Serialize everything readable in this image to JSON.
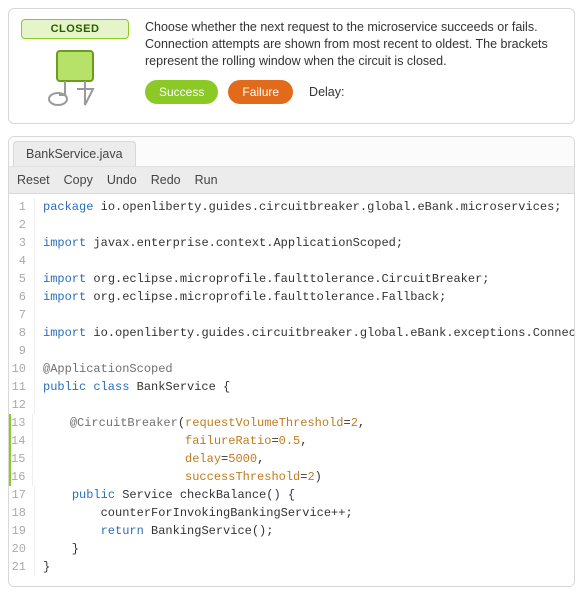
{
  "status": {
    "label": "CLOSED",
    "accent_color": "#8ac926",
    "fill_color": "#e6f5c9"
  },
  "description": "Choose whether the next request to the microservice succeeds or fails. Connection attempts are shown from most recent to oldest. The brackets represent the rolling window when the circuit is closed.",
  "controls": {
    "success_label": "Success",
    "failure_label": "Failure",
    "delay_label": "Delay:"
  },
  "tabs": [
    {
      "label": "BankService.java",
      "active": true
    }
  ],
  "toolbar": {
    "reset": "Reset",
    "copy": "Copy",
    "undo": "Undo",
    "redo": "Redo",
    "run": "Run"
  },
  "highlight_lines": [
    13,
    14,
    15,
    16
  ],
  "code": [
    {
      "n": 1,
      "tokens": [
        [
          "kw",
          "package"
        ],
        [
          "",
          " io.openliberty.guides.circuitbreaker.global.eBank.microservices;"
        ]
      ]
    },
    {
      "n": 2,
      "tokens": []
    },
    {
      "n": 3,
      "tokens": [
        [
          "kw",
          "import"
        ],
        [
          "",
          " javax.enterprise.context.ApplicationScoped;"
        ]
      ]
    },
    {
      "n": 4,
      "tokens": []
    },
    {
      "n": 5,
      "tokens": [
        [
          "kw",
          "import"
        ],
        [
          "",
          " org.eclipse.microprofile.faulttolerance.CircuitBreaker;"
        ]
      ]
    },
    {
      "n": 6,
      "tokens": [
        [
          "kw",
          "import"
        ],
        [
          "",
          " org.eclipse.microprofile.faulttolerance.Fallback;"
        ]
      ]
    },
    {
      "n": 7,
      "tokens": []
    },
    {
      "n": 8,
      "tokens": [
        [
          "kw",
          "import"
        ],
        [
          "",
          " io.openliberty.guides.circuitbreaker.global.eBank.exceptions.ConnectException;"
        ]
      ]
    },
    {
      "n": 9,
      "tokens": []
    },
    {
      "n": 10,
      "tokens": [
        [
          "ann",
          "@ApplicationScoped"
        ]
      ]
    },
    {
      "n": 11,
      "tokens": [
        [
          "kw",
          "public class"
        ],
        [
          "",
          " BankService {"
        ]
      ]
    },
    {
      "n": 12,
      "tokens": []
    },
    {
      "n": 13,
      "tokens": [
        [
          "",
          "    "
        ],
        [
          "ann",
          "@CircuitBreaker"
        ],
        [
          "",
          "("
        ],
        [
          "param",
          "requestVolumeThreshold"
        ],
        [
          "",
          "="
        ],
        [
          "num",
          "2"
        ],
        [
          "",
          ","
        ]
      ]
    },
    {
      "n": 14,
      "tokens": [
        [
          "",
          "                    "
        ],
        [
          "param",
          "failureRatio"
        ],
        [
          "",
          "="
        ],
        [
          "num",
          "0.5"
        ],
        [
          "",
          ","
        ]
      ]
    },
    {
      "n": 15,
      "tokens": [
        [
          "",
          "                    "
        ],
        [
          "param",
          "delay"
        ],
        [
          "",
          "="
        ],
        [
          "num",
          "5000"
        ],
        [
          "",
          ","
        ]
      ]
    },
    {
      "n": 16,
      "tokens": [
        [
          "",
          "                    "
        ],
        [
          "param",
          "successThreshold"
        ],
        [
          "",
          "="
        ],
        [
          "num",
          "2"
        ],
        [
          "",
          ")"
        ]
      ]
    },
    {
      "n": 17,
      "tokens": [
        [
          "",
          "    "
        ],
        [
          "kw",
          "public"
        ],
        [
          "",
          " Service checkBalance() {"
        ]
      ]
    },
    {
      "n": 18,
      "tokens": [
        [
          "",
          "        counterForInvokingBankingService++;"
        ]
      ]
    },
    {
      "n": 19,
      "tokens": [
        [
          "",
          "        "
        ],
        [
          "kw",
          "return"
        ],
        [
          "",
          " BankingService();"
        ]
      ]
    },
    {
      "n": 20,
      "tokens": [
        [
          "",
          "    }"
        ]
      ]
    },
    {
      "n": 21,
      "tokens": [
        [
          "",
          "}"
        ]
      ]
    }
  ]
}
